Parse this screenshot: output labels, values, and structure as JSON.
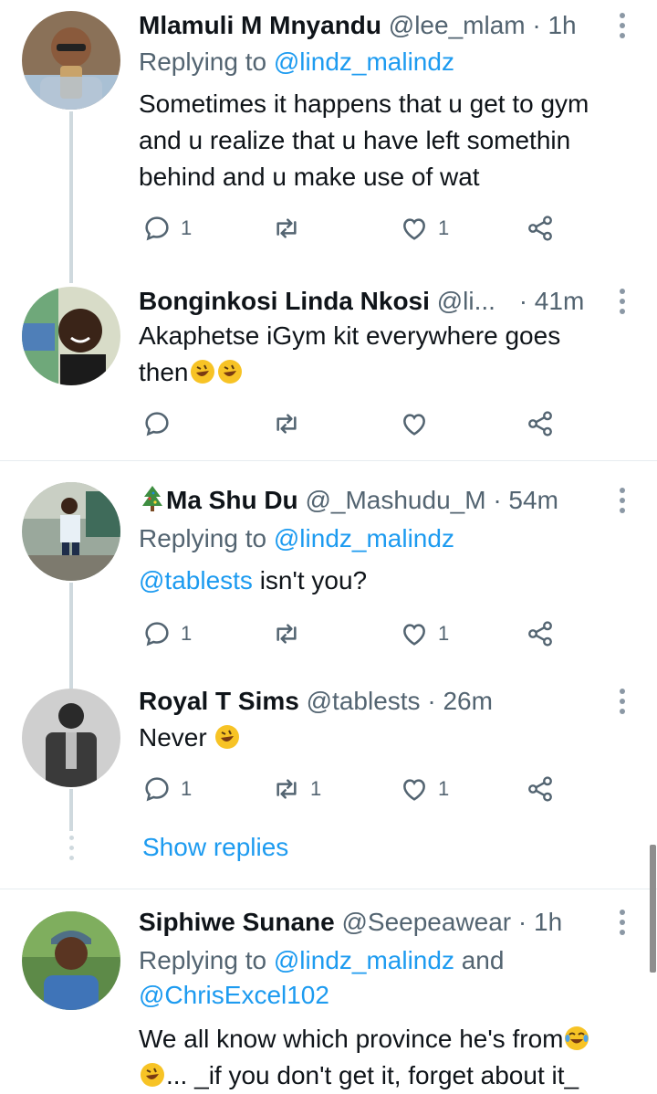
{
  "tweets": [
    {
      "name": "Mlamuli M Mnyandu",
      "handle": "@lee_mlam",
      "dot": "·",
      "time": "1h",
      "replying_prefix": "Replying to",
      "replying_to": "@lindz_malindz",
      "text_lines": [
        "Sometimes it happens that u get to gym",
        "and u realize that u have left somethin",
        "behind and u make use of wat"
      ],
      "counts": {
        "reply": "1",
        "retweet": "",
        "like": "1"
      }
    },
    {
      "name": "Bonginkosi Linda Nkosi",
      "handle": "@li...",
      "dot": "·",
      "time": "41m",
      "text_lines": [
        "Akaphetse iGym kit everywhere goes",
        "then"
      ],
      "counts": {
        "reply": "",
        "retweet": "",
        "like": ""
      }
    },
    {
      "name_prefix_icon": "christmas-tree-icon",
      "name": "Ma Shu Du",
      "handle": "@_Mashudu_M",
      "dot": "·",
      "time": "54m",
      "replying_prefix": "Replying to",
      "replying_to": "@lindz_malindz",
      "text_mention": "@tablests",
      "text_rest": " isn't you?",
      "counts": {
        "reply": "1",
        "retweet": "",
        "like": "1"
      }
    },
    {
      "name": "Royal T Sims",
      "handle": "@tablests",
      "dot": "·",
      "time": "26m",
      "text": "Never",
      "counts": {
        "reply": "1",
        "retweet": "1",
        "like": "1"
      }
    },
    {
      "name": "Siphiwe Sunane",
      "handle": "@Seepeawear",
      "dot": "·",
      "time": "1h",
      "replying_prefix": "Replying to",
      "replying_to": "@lindz_malindz",
      "replying_and": " and",
      "replying_to2": "@ChrisExcel102",
      "text_line1": "We all know which province he's from",
      "text_line2": "... _if you don't get it, forget about it_"
    }
  ],
  "show_replies": "Show replies",
  "colors": {
    "accent": "#1d9bf0",
    "secondary": "#536471",
    "thread": "#cfd9de"
  }
}
